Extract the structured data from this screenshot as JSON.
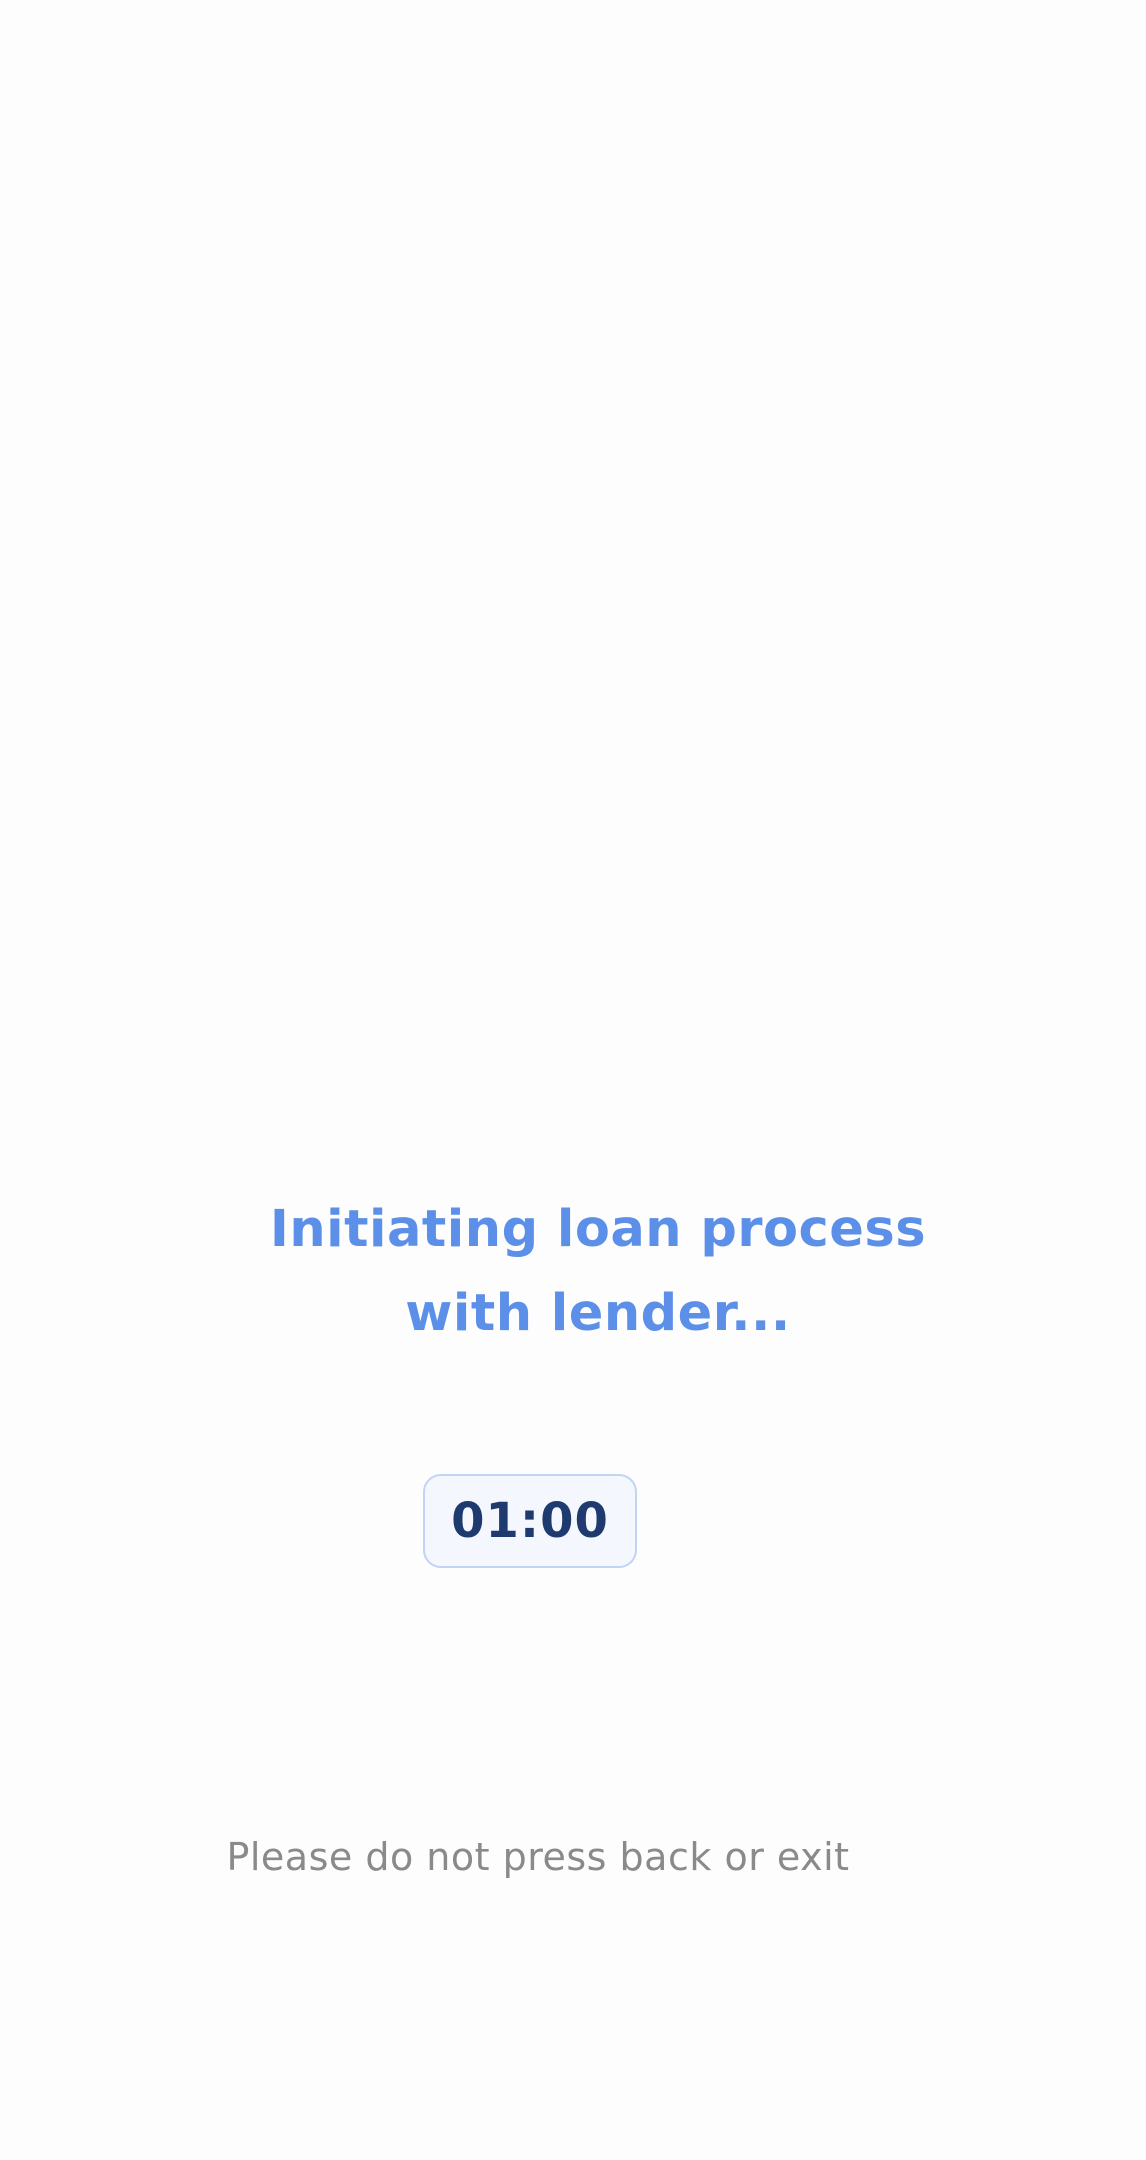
{
  "loading": {
    "title_line1": "Initiating loan process",
    "title_line2": "with lender...",
    "timer": "01:00",
    "notice": "Please do not press back or exit"
  },
  "colors": {
    "title": "#5b8fe8",
    "timer_text": "#1f3a6e",
    "timer_border": "#c2d4f5",
    "timer_bg": "#f4f7fd",
    "notice": "#8a8a8a",
    "background": "#fdfdfd"
  }
}
